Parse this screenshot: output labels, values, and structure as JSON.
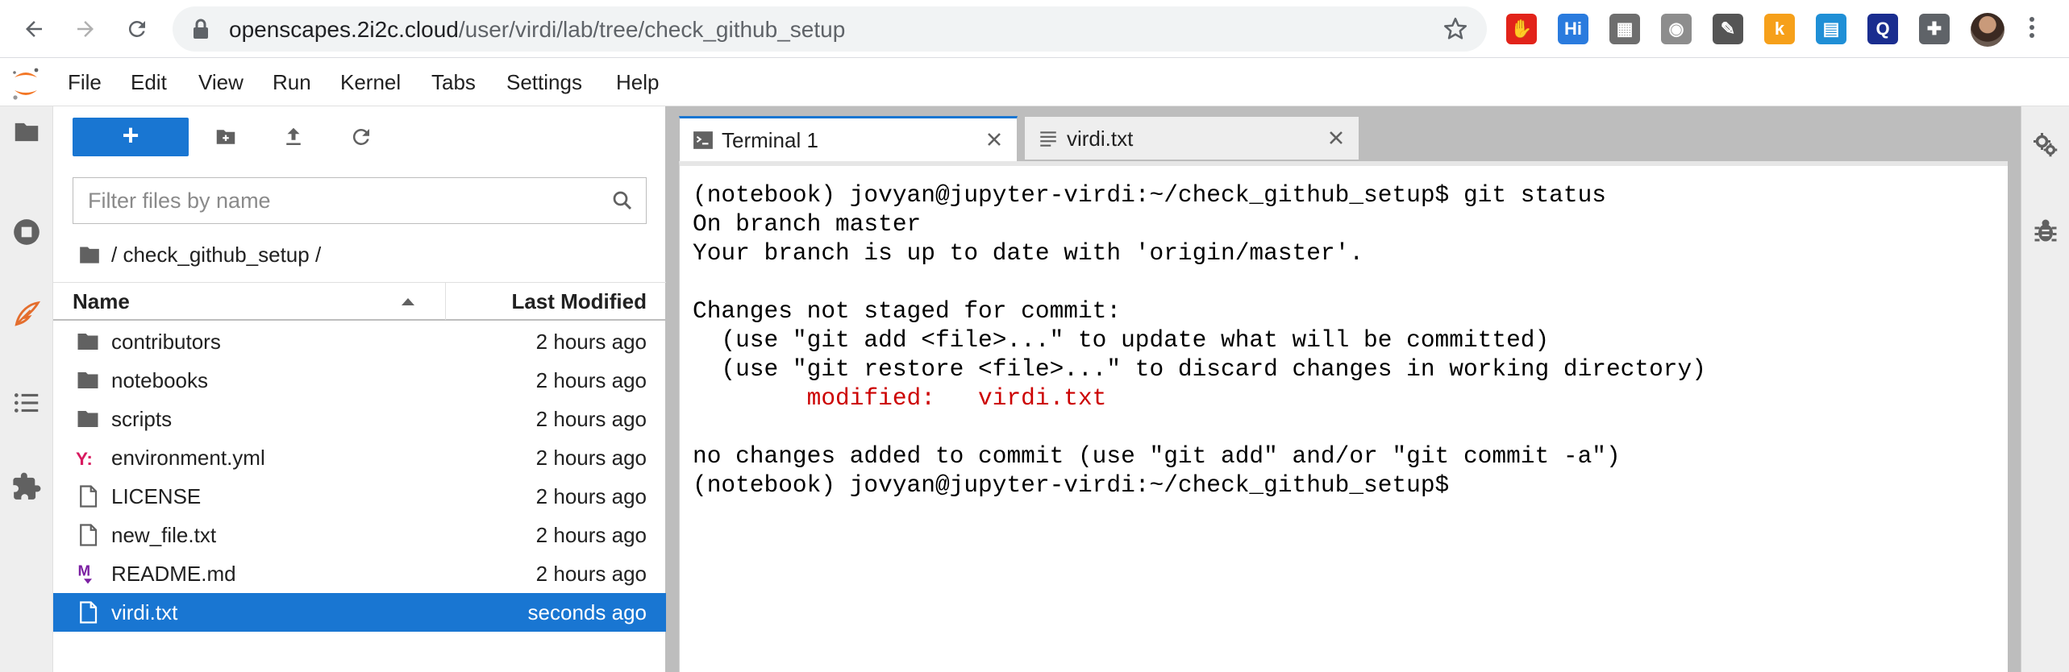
{
  "browser": {
    "url_host": "openscapes.2i2c.cloud",
    "url_path": "/user/virdi/lab/tree/check_github_setup",
    "extensions": [
      {
        "name": "adblock-icon",
        "color": "#e2231a",
        "label": "✋"
      },
      {
        "name": "highlighter-icon",
        "color": "#2a7bde",
        "label": "Hi"
      },
      {
        "name": "image-extension-icon",
        "color": "#6e6e6e",
        "label": "▦"
      },
      {
        "name": "camera-icon",
        "color": "#8d8d8d",
        "label": "◉"
      },
      {
        "name": "ruler-extension-icon",
        "color": "#555555",
        "label": "✎"
      },
      {
        "name": "k-extension-icon",
        "color": "#f6a01a",
        "label": "k"
      },
      {
        "name": "reader-extension-icon",
        "color": "#1f8fd6",
        "label": "▤"
      },
      {
        "name": "q-extension-icon",
        "color": "#1a2d8f",
        "label": "Q"
      },
      {
        "name": "puzzle-extensions-icon",
        "color": "#5f6368",
        "label": "✚"
      }
    ]
  },
  "menubar": {
    "items": [
      "File",
      "Edit",
      "View",
      "Run",
      "Kernel",
      "Tabs",
      "Settings",
      "Help"
    ]
  },
  "file_browser": {
    "new_label": "+",
    "filter_placeholder": "Filter files by name",
    "breadcrumb": "/ check_github_setup /",
    "col_name": "Name",
    "col_modified": "Last Modified",
    "files": [
      {
        "name": "contributors",
        "modified": "2 hours ago",
        "icon": "folder-icon"
      },
      {
        "name": "notebooks",
        "modified": "2 hours ago",
        "icon": "folder-icon"
      },
      {
        "name": "scripts",
        "modified": "2 hours ago",
        "icon": "folder-icon"
      },
      {
        "name": "environment.yml",
        "modified": "2 hours ago",
        "icon": "yaml-file-icon"
      },
      {
        "name": "LICENSE",
        "modified": "2 hours ago",
        "icon": "file-icon"
      },
      {
        "name": "new_file.txt",
        "modified": "2 hours ago",
        "icon": "file-icon"
      },
      {
        "name": "README.md",
        "modified": "2 hours ago",
        "icon": "markdown-file-icon"
      },
      {
        "name": "virdi.txt",
        "modified": "seconds ago",
        "icon": "file-icon",
        "selected": true
      }
    ]
  },
  "tabs": [
    {
      "label": "Terminal 1",
      "icon": "terminal-icon",
      "active": true
    },
    {
      "label": "virdi.txt",
      "icon": "text-file-icon",
      "active": false
    }
  ],
  "terminal": {
    "lines": [
      {
        "text": "(notebook) jovyan@jupyter-virdi:~/check_github_setup$ git status"
      },
      {
        "text": "On branch master"
      },
      {
        "text": "Your branch is up to date with 'origin/master'."
      },
      {
        "text": ""
      },
      {
        "text": "Changes not staged for commit:"
      },
      {
        "text": "  (use \"git add <file>...\" to update what will be committed)"
      },
      {
        "text": "  (use \"git restore <file>...\" to discard changes in working directory)"
      },
      {
        "text": "        modified:   virdi.txt",
        "color": "red"
      },
      {
        "text": ""
      },
      {
        "text": "no changes added to commit (use \"git add\" and/or \"git commit -a\")"
      },
      {
        "text": "(notebook) jovyan@jupyter-virdi:~/check_github_setup$ "
      }
    ]
  }
}
